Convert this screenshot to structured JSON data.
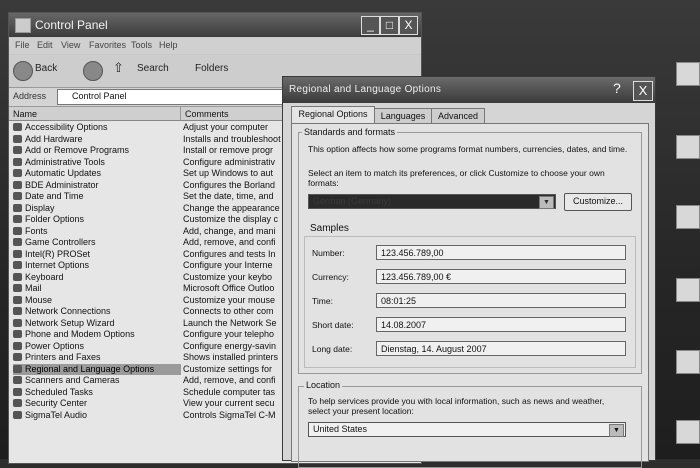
{
  "control_panel": {
    "title": "Control Panel",
    "window_buttons": {
      "minimize": "_",
      "maximize": "□",
      "close": "X"
    },
    "menu": [
      "File",
      "Edit",
      "View",
      "Favorites",
      "Tools",
      "Help"
    ],
    "toolbar": {
      "back": "Back",
      "search": "Search",
      "folders": "Folders"
    },
    "address": {
      "label": "Address",
      "value": "Control Panel"
    },
    "columns": {
      "name": "Name",
      "comments": "Comments"
    },
    "items": [
      {
        "name": "Accessibility Options",
        "comment": "Adjust your computer"
      },
      {
        "name": "Add Hardware",
        "comment": "Installs and troubleshoot"
      },
      {
        "name": "Add or Remove Programs",
        "comment": "Install or remove progr"
      },
      {
        "name": "Administrative Tools",
        "comment": "Configure administrativ"
      },
      {
        "name": "Automatic Updates",
        "comment": "Set up Windows to aut"
      },
      {
        "name": "BDE Administrator",
        "comment": "Configures the Borland"
      },
      {
        "name": "Date and Time",
        "comment": "Set the date, time, and"
      },
      {
        "name": "Display",
        "comment": "Change the appearance"
      },
      {
        "name": "Folder Options",
        "comment": "Customize the display c"
      },
      {
        "name": "Fonts",
        "comment": "Add, change, and mani"
      },
      {
        "name": "Game Controllers",
        "comment": "Add, remove, and confi"
      },
      {
        "name": "Intel(R) PROSet",
        "comment": "Configures and tests In"
      },
      {
        "name": "Internet Options",
        "comment": "Configure your Interne"
      },
      {
        "name": "Keyboard",
        "comment": "Customize your keybo"
      },
      {
        "name": "Mail",
        "comment": "Microsoft Office Outloo"
      },
      {
        "name": "Mouse",
        "comment": "Customize your mouse"
      },
      {
        "name": "Network Connections",
        "comment": "Connects to other com"
      },
      {
        "name": "Network Setup Wizard",
        "comment": "Launch the Network Se"
      },
      {
        "name": "Phone and Modem Options",
        "comment": "Configure your telepho"
      },
      {
        "name": "Power Options",
        "comment": "Configure energy-savin"
      },
      {
        "name": "Printers and Faxes",
        "comment": "Shows installed printers"
      },
      {
        "name": "Regional and Language Options",
        "comment": "Customize settings for"
      },
      {
        "name": "Scanners and Cameras",
        "comment": "Add, remove, and confi"
      },
      {
        "name": "Scheduled Tasks",
        "comment": "Schedule computer tas"
      },
      {
        "name": "Security Center",
        "comment": "View your current secu"
      },
      {
        "name": "SigmaTel Audio",
        "comment": "Controls SigmaTel C-M"
      }
    ]
  },
  "dialog": {
    "title": "Regional and Language Options",
    "help": "?",
    "close": "X",
    "tabs": [
      "Regional Options",
      "Languages",
      "Advanced"
    ],
    "standards": {
      "title": "Standards and formats",
      "description": "This option affects how some programs format numbers, currencies, dates, and time.",
      "instruction": "Select an item to match its preferences, or click Customize to choose your own formats:",
      "selected": "German (Germany)",
      "customize": "Customize..."
    },
    "samples": {
      "title": "Samples",
      "rows": [
        {
          "label": "Number:",
          "value": "123.456.789,00"
        },
        {
          "label": "Currency:",
          "value": "123.456.789,00 €"
        },
        {
          "label": "Time:",
          "value": "08:01:25"
        },
        {
          "label": "Short date:",
          "value": "14.08.2007"
        },
        {
          "label": "Long date:",
          "value": "Dienstag, 14. August 2007"
        }
      ]
    },
    "location": {
      "title": "Location",
      "description": "To help services provide you with local information, such as news and weather, select your present location:",
      "value": "United States"
    }
  }
}
